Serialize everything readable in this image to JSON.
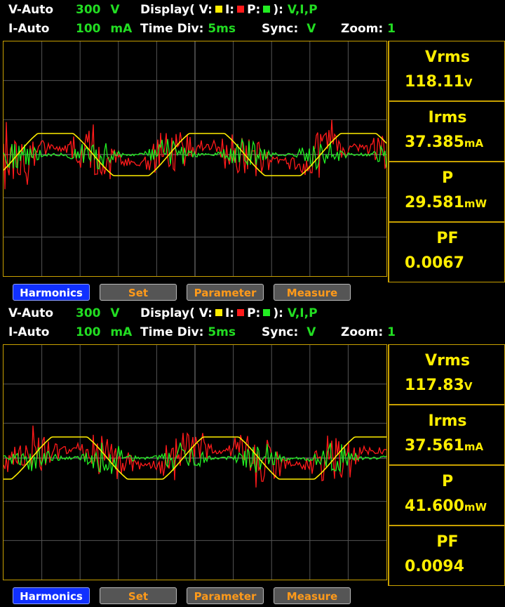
{
  "panels": [
    {
      "header": {
        "v_range_label": "V-Auto",
        "v_range_value": "300",
        "v_range_unit": "V",
        "display_label": "Display( V:",
        "display_i": "I:",
        "display_p": "P:",
        "display_close": "):",
        "display_value": "V,I,P",
        "i_range_label": "I-Auto",
        "i_range_value": "100",
        "i_range_unit": "mA",
        "time_div_label": "Time  Div:",
        "time_div_value": "5ms",
        "sync_label": "Sync:",
        "sync_value": "V",
        "zoom_label": "Zoom:",
        "zoom_value": "1"
      },
      "meters": [
        {
          "label": "Vrms",
          "value": "118.11",
          "unit": "V"
        },
        {
          "label": "Irms",
          "value": "37.385",
          "unit": "mA"
        },
        {
          "label": "P",
          "value": "29.581",
          "unit": "mW"
        },
        {
          "label": "PF",
          "value": "0.0067",
          "unit": ""
        }
      ],
      "buttons": {
        "harmonics": "Harmonics",
        "set": "Set",
        "parameter": "Parameter",
        "measure": "Measure"
      }
    },
    {
      "header": {
        "v_range_label": "V-Auto",
        "v_range_value": "300",
        "v_range_unit": "V",
        "display_label": "Display( V:",
        "display_i": "I:",
        "display_p": "P:",
        "display_close": "):",
        "display_value": "V,I,P",
        "i_range_label": "I-Auto",
        "i_range_value": "100",
        "i_range_unit": "mA",
        "time_div_label": "Time  Div:",
        "time_div_value": "5ms",
        "sync_label": "Sync:",
        "sync_value": "V",
        "zoom_label": "Zoom:",
        "zoom_value": "1"
      },
      "meters": [
        {
          "label": "Vrms",
          "value": "117.83",
          "unit": "V"
        },
        {
          "label": "Irms",
          "value": "37.561",
          "unit": "mA"
        },
        {
          "label": "P",
          "value": "41.600",
          "unit": "mW"
        },
        {
          "label": "PF",
          "value": "0.0094",
          "unit": ""
        }
      ],
      "buttons": {
        "harmonics": "Harmonics",
        "set": "Set",
        "parameter": "Parameter",
        "measure": "Measure"
      }
    }
  ],
  "colors": {
    "voltage": "#ffee00",
    "current": "#ff1a1a",
    "power": "#22ee22",
    "grid": "#555555",
    "frame": "#c8a000",
    "accent_text": "#22dd22",
    "meter_text": "#ffee00"
  }
}
